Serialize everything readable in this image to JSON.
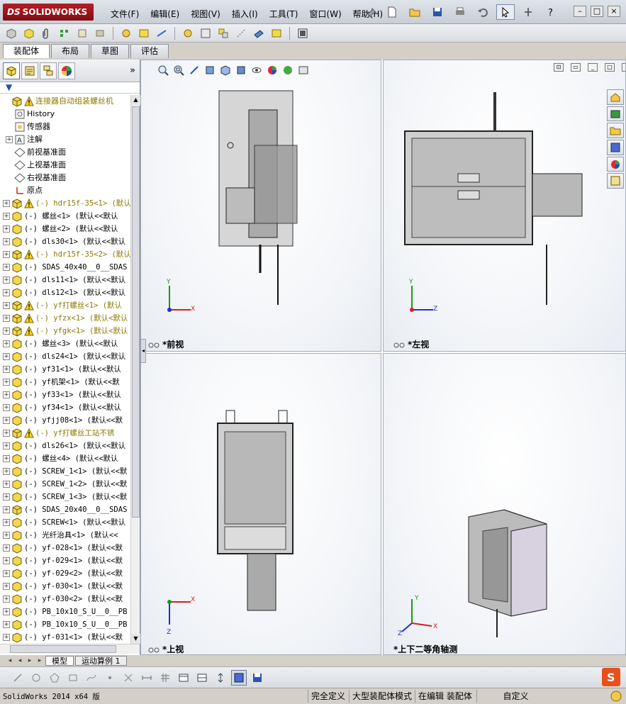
{
  "app": {
    "logo_text": "SOLIDWORKS",
    "logo_prefix": "DS"
  },
  "menu": [
    "文件(F)",
    "编辑(E)",
    "视图(V)",
    "插入(I)",
    "工具(T)",
    "窗口(W)",
    "帮助(H)"
  ],
  "command_tabs": [
    "装配体",
    "布局",
    "草图",
    "评估"
  ],
  "feature_tree": {
    "root": "连接器自动组装螺丝机",
    "features": [
      "History",
      "传感器",
      "注解",
      "前视基准面",
      "上视基准面",
      "右视基准面",
      "原点"
    ],
    "components": [
      {
        "label": "(-) hdr15f-35<1> (默认",
        "warn": true
      },
      {
        "label": "(-) 螺丝<1> (默认<<默认",
        "warn": false
      },
      {
        "label": "(-) 螺丝<2> (默认<<默认",
        "warn": false
      },
      {
        "label": "(-) dls30<1> (默认<<默认",
        "warn": false
      },
      {
        "label": "(-) hdr15f-35<2> (默认",
        "warn": true
      },
      {
        "label": "(-) SDAS_40x40__0__SDAS",
        "warn": false
      },
      {
        "label": "(-) dls11<1> (默认<<默认",
        "warn": false
      },
      {
        "label": "(-) dls12<1> (默认<<默认",
        "warn": false
      },
      {
        "label": "(-) yf打螺丝<1> (默认",
        "warn": true
      },
      {
        "label": "(-) yfzx<1> (默认<默认",
        "warn": true
      },
      {
        "label": "(-) yfgk<1> (默认<默认",
        "warn": true
      },
      {
        "label": "(-) 螺丝<3> (默认<<默认",
        "warn": false
      },
      {
        "label": "(-) dls24<1> (默认<<默认",
        "warn": false
      },
      {
        "label": "(-) yf31<1> (默认<<默认",
        "warn": false
      },
      {
        "label": "(-) yf机架<1> (默认<<默",
        "warn": false
      },
      {
        "label": "(-) yf33<1> (默认<<默认",
        "warn": false
      },
      {
        "label": "(-) yf34<1> (默认<<默认",
        "warn": false
      },
      {
        "label": "(-) yfjj08<1> (默认<<默",
        "warn": false
      },
      {
        "label": "(-) yf打螺丝工站不锈",
        "warn": true
      },
      {
        "label": "(-) dls26<1> (默认<<默认",
        "warn": false
      },
      {
        "label": "(-) 螺丝<4> (默认<<默认",
        "warn": false
      },
      {
        "label": "(-) SCREW_1<1> (默认<<默",
        "warn": false
      },
      {
        "label": "(-) SCREW_1<2> (默认<<默",
        "warn": false
      },
      {
        "label": "(-) SCREW_1<3> (默认<<默",
        "warn": false
      },
      {
        "label": "(-) SDAS_20x40__0__SDAS",
        "warn": false
      },
      {
        "label": "(-) SCREW<1> (默认<<默认",
        "warn": false
      },
      {
        "label": "(-) 光纤治具<1> (默认<<",
        "warn": false
      },
      {
        "label": "(-) yf-028<1> (默认<<默",
        "warn": false
      },
      {
        "label": "(-) yf-029<1> (默认<<默",
        "warn": false
      },
      {
        "label": "(-) yf-029<2> (默认<<默",
        "warn": false
      },
      {
        "label": "(-) yf-030<1> (默认<<默",
        "warn": false
      },
      {
        "label": "(-) yf-030<2> (默认<<默",
        "warn": false
      },
      {
        "label": "(-) PB_10x10_S_U__0__PB",
        "warn": false
      },
      {
        "label": "(-) PB_10x10_S_U__0__PB",
        "warn": false
      },
      {
        "label": "(-) yf-031<1> (默认<<默",
        "warn": false
      }
    ]
  },
  "viewports": {
    "front": {
      "label": "*前视",
      "axis1": "Y",
      "axis2": "X"
    },
    "left": {
      "label": "*左视",
      "axis1": "Y",
      "axis2": "Z"
    },
    "top": {
      "label": "*上视",
      "axis1": "Z",
      "axis2": "X"
    },
    "iso": {
      "label": "*上下二等角轴测",
      "axis1": "Y",
      "axis2": "X",
      "axis3": "Z"
    }
  },
  "bottom_tabs": [
    "模型",
    "运动算例 1"
  ],
  "status": {
    "app_version": "SolidWorks 2014 x64 版",
    "cells": [
      "完全定义",
      "大型装配体模式",
      "在编辑 装配体",
      "自定义"
    ]
  },
  "colors": {
    "accent_red": "#b61e26",
    "warn_text": "#8a7a00",
    "axis_x": "#d62020",
    "axis_y": "#1a9a1a",
    "axis_z": "#2030c8"
  }
}
